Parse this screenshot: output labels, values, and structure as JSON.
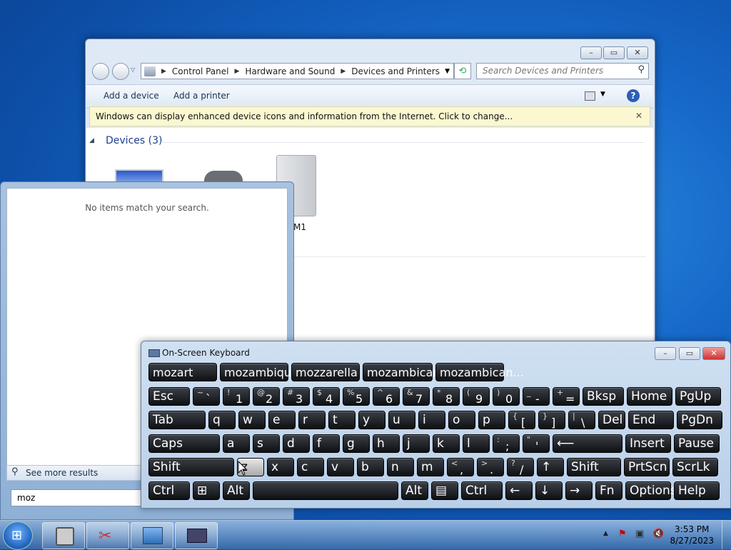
{
  "explorer": {
    "breadcrumbs": [
      "Control Panel",
      "Hardware and Sound",
      "Devices and Printers"
    ],
    "search_placeholder": "Search Devices and Printers",
    "toolbar": {
      "add_device": "Add a device",
      "add_printer": "Add a printer"
    },
    "infobar_text": "Windows can display enhanced device icons and information from the Internet. Click to change...",
    "group_header": "Devices (3)",
    "device_label_partial": "M1"
  },
  "start_search": {
    "no_items": "No items match your search.",
    "see_more": "See more results",
    "query": "moz"
  },
  "osk": {
    "title": "On-Screen Keyboard",
    "suggestions": [
      "mozart",
      "mozambique",
      "mozzarella",
      "mozambican",
      "mozambican..."
    ],
    "row1": [
      {
        "l": "Esc"
      },
      {
        "s": "~",
        "m": "`"
      },
      {
        "s": "!",
        "m": "1"
      },
      {
        "s": "@",
        "m": "2"
      },
      {
        "s": "#",
        "m": "3"
      },
      {
        "s": "$",
        "m": "4"
      },
      {
        "s": "%",
        "m": "5"
      },
      {
        "s": "^",
        "m": "6"
      },
      {
        "s": "&",
        "m": "7"
      },
      {
        "s": "*",
        "m": "8"
      },
      {
        "s": "(",
        "m": "9"
      },
      {
        "s": ")",
        "m": "0"
      },
      {
        "s": "_",
        "m": "-"
      },
      {
        "s": "+",
        "m": "="
      },
      {
        "l": "Bksp"
      },
      {
        "l": "Home"
      },
      {
        "l": "PgUp"
      }
    ],
    "row2": [
      "Tab",
      "q",
      "w",
      "e",
      "r",
      "t",
      "y",
      "u",
      "i",
      "o",
      "p",
      {
        "s": "{",
        "m": "["
      },
      {
        "s": "}",
        "m": "]"
      },
      {
        "s": "|",
        "m": "\\"
      },
      "Del",
      "End",
      "PgDn"
    ],
    "row3": [
      "Caps",
      "a",
      "s",
      "d",
      "f",
      "g",
      "h",
      "j",
      "k",
      "l",
      {
        "s": ":",
        "m": ";"
      },
      {
        "s": "\"",
        "m": "'"
      },
      "⟵",
      "Insert",
      "Pause"
    ],
    "row4": [
      "Shift",
      "z",
      "x",
      "c",
      "v",
      "b",
      "n",
      "m",
      {
        "s": "<",
        "m": ","
      },
      {
        "s": ">",
        "m": "."
      },
      {
        "s": "?",
        "m": "/"
      },
      "↑",
      "Shift",
      "PrtScn",
      "ScrLk"
    ],
    "row5": [
      "Ctrl",
      "⊞",
      "Alt",
      "",
      "Alt",
      "▤",
      "Ctrl",
      "←",
      "↓",
      "→",
      "Fn",
      "Options",
      "Help"
    ]
  },
  "taskbar": {
    "time": "3:53 PM",
    "date": "8/27/2023"
  }
}
